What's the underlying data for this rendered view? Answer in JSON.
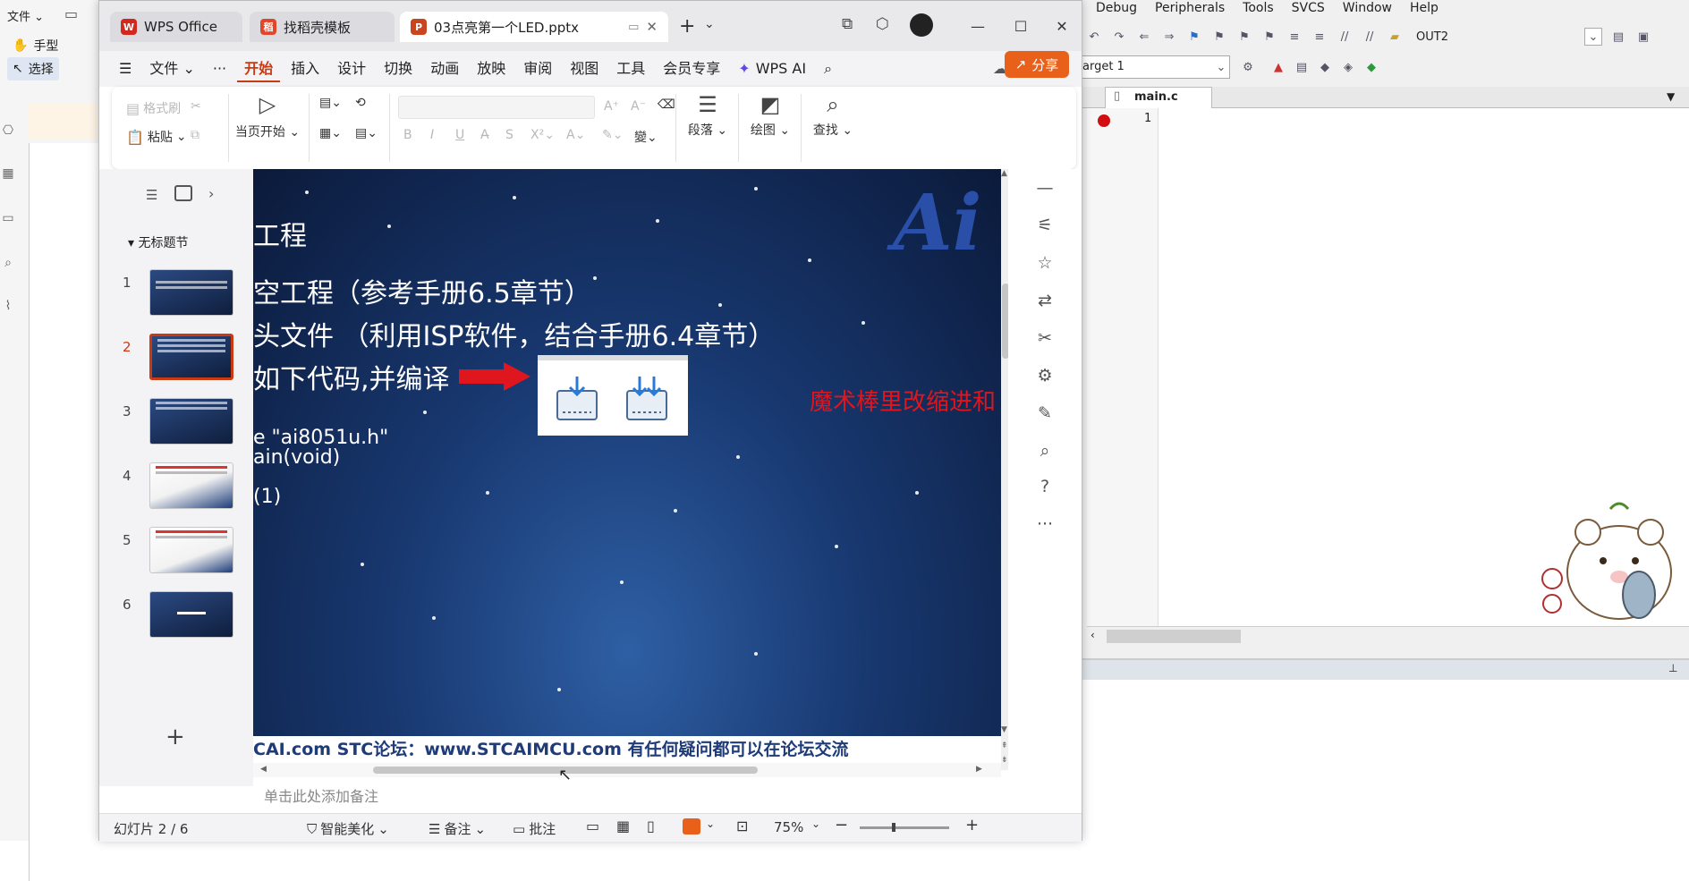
{
  "bg_pdf": {
    "menu_file": "文件",
    "tool_hand": "手型",
    "tool_select": "选择"
  },
  "keil": {
    "menu": [
      "Debug",
      "Peripherals",
      "Tools",
      "SVCS",
      "Window",
      "Help"
    ],
    "target_combo": "OUT2",
    "target_name": "arget 1",
    "editor_tab": "main.c",
    "line_number": "1"
  },
  "wps": {
    "tabs": [
      {
        "label": "WPS Office"
      },
      {
        "label": "找稻壳模板"
      },
      {
        "label": "03点亮第一个LED.pptx"
      }
    ],
    "menu_file": "文件",
    "menus": [
      "开始",
      "插入",
      "设计",
      "切换",
      "动画",
      "放映",
      "审阅",
      "视图",
      "工具",
      "会员专享"
    ],
    "wps_ai": "WPS AI",
    "share": "分享",
    "ribbon": {
      "format_painter": "格式刷",
      "paste": "粘贴",
      "start_from_current": "当页开始",
      "paragraph": "段落",
      "draw": "绘图",
      "find": "查找"
    },
    "section_label": "无标题节",
    "slide_numbers": [
      "1",
      "2",
      "3",
      "4",
      "5",
      "6"
    ],
    "slide": {
      "line1": "工程",
      "line2": "空工程（参考手册6.5章节）",
      "line3": "头文件 （利用ISP软件，结合手册6.4章节）",
      "line4": "如下代码,并编译",
      "code1": "e \"ai8051u.h\"",
      "code2": "ain(void)",
      "code3": "(1)",
      "red_caption": "魔术棒里改缩进和",
      "ai_logo": "Ai",
      "footer": "CAI.com      STC论坛：www.STCAIMCU.com      有任何疑问都可以在论坛交流"
    },
    "notes_placeholder": "单击此处添加备注",
    "status": {
      "slide_info": "幻灯片 2 / 6",
      "beautify": "智能美化",
      "notes": "备注",
      "comments": "批注",
      "zoom": "75%"
    }
  }
}
